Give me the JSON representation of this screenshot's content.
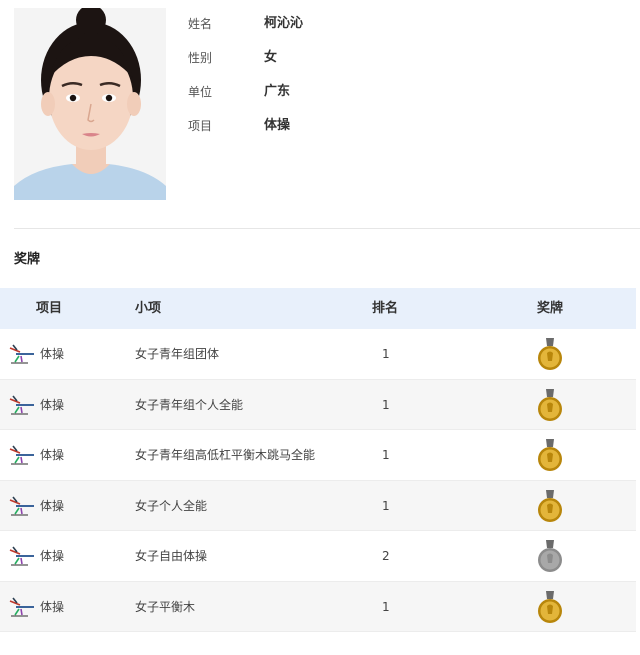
{
  "profile": {
    "fields": [
      {
        "label": "姓名",
        "value": "柯沁沁"
      },
      {
        "label": "性别",
        "value": "女"
      },
      {
        "label": "单位",
        "value": "广东"
      },
      {
        "label": "项目",
        "value": "体操"
      }
    ]
  },
  "medals_section": {
    "title": "奖牌",
    "headers": {
      "sport": "项目",
      "event": "小项",
      "rank": "排名",
      "medal": "奖牌"
    },
    "rows": [
      {
        "sport": "体操",
        "event": "女子青年组团体",
        "rank": "1",
        "medal": "gold-medal-icon"
      },
      {
        "sport": "体操",
        "event": "女子青年组个人全能",
        "rank": "1",
        "medal": "gold-medal-icon"
      },
      {
        "sport": "体操",
        "event": "女子青年组高低杠平衡木跳马全能",
        "rank": "1",
        "medal": "gold-medal-icon"
      },
      {
        "sport": "体操",
        "event": "女子个人全能",
        "rank": "1",
        "medal": "gold-medal-icon"
      },
      {
        "sport": "体操",
        "event": "女子自由体操",
        "rank": "2",
        "medal": "silver-medal-icon"
      },
      {
        "sport": "体操",
        "event": "女子平衡木",
        "rank": "1",
        "medal": "gold-medal-icon"
      }
    ]
  },
  "colors": {
    "header_bg": "#e8f0fb",
    "gold": "#d4a017",
    "silver": "#a8a8a8",
    "row_alt": "#f6f6f6"
  }
}
